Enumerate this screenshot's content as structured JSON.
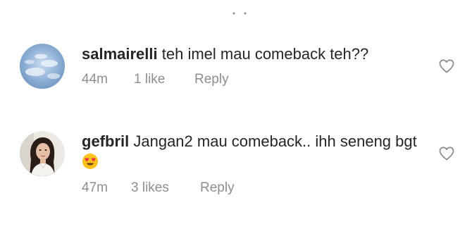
{
  "comments": [
    {
      "username": "salmairelli",
      "text": "teh imel mau comeback teh??",
      "time": "44m",
      "likes": "1 like",
      "reply": "Reply"
    },
    {
      "username": "gefbril",
      "text": "Jangan2 mau comeback.. ihh seneng bgt",
      "time": "47m",
      "likes": "3 likes",
      "reply": "Reply"
    }
  ],
  "colors": {
    "text": "#262626",
    "meta": "#8e8e8e",
    "heart_outline": "#8e8e8e"
  }
}
